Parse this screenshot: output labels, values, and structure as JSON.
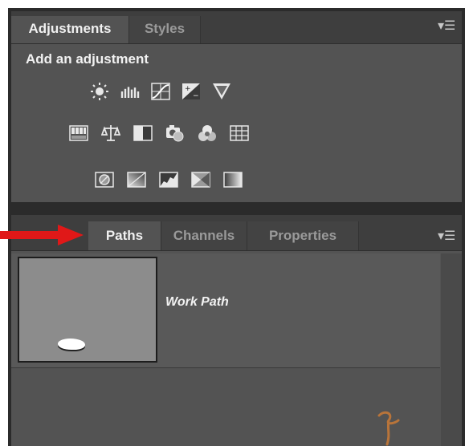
{
  "adjustments_panel": {
    "tabs": [
      {
        "label": "Adjustments",
        "active": true
      },
      {
        "label": "Styles",
        "active": false
      }
    ],
    "menu_icon": "panel-menu-icon",
    "title": "Add an adjustment",
    "icon_rows": [
      [
        "brightness-contrast-icon",
        "levels-icon",
        "curves-icon",
        "exposure-icon",
        "vibrance-icon"
      ],
      [
        "hue-saturation-icon",
        "color-balance-icon",
        "black-white-icon",
        "photo-filter-icon",
        "channel-mixer-icon",
        "color-lookup-icon"
      ],
      [
        "invert-icon",
        "posterize-icon",
        "threshold-icon",
        "selective-color-icon",
        "gradient-map-icon"
      ]
    ]
  },
  "paths_panel": {
    "tabs": [
      {
        "label": "Paths",
        "active": true
      },
      {
        "label": "Channels",
        "active": false
      },
      {
        "label": "Properties",
        "active": false
      }
    ],
    "menu_icon": "panel-menu-icon",
    "paths": [
      {
        "name": "Work Path"
      }
    ]
  },
  "colors": {
    "panel_bg": "#535353",
    "tab_bar_bg": "#3e3e3e",
    "arrow_red": "#e01818"
  }
}
